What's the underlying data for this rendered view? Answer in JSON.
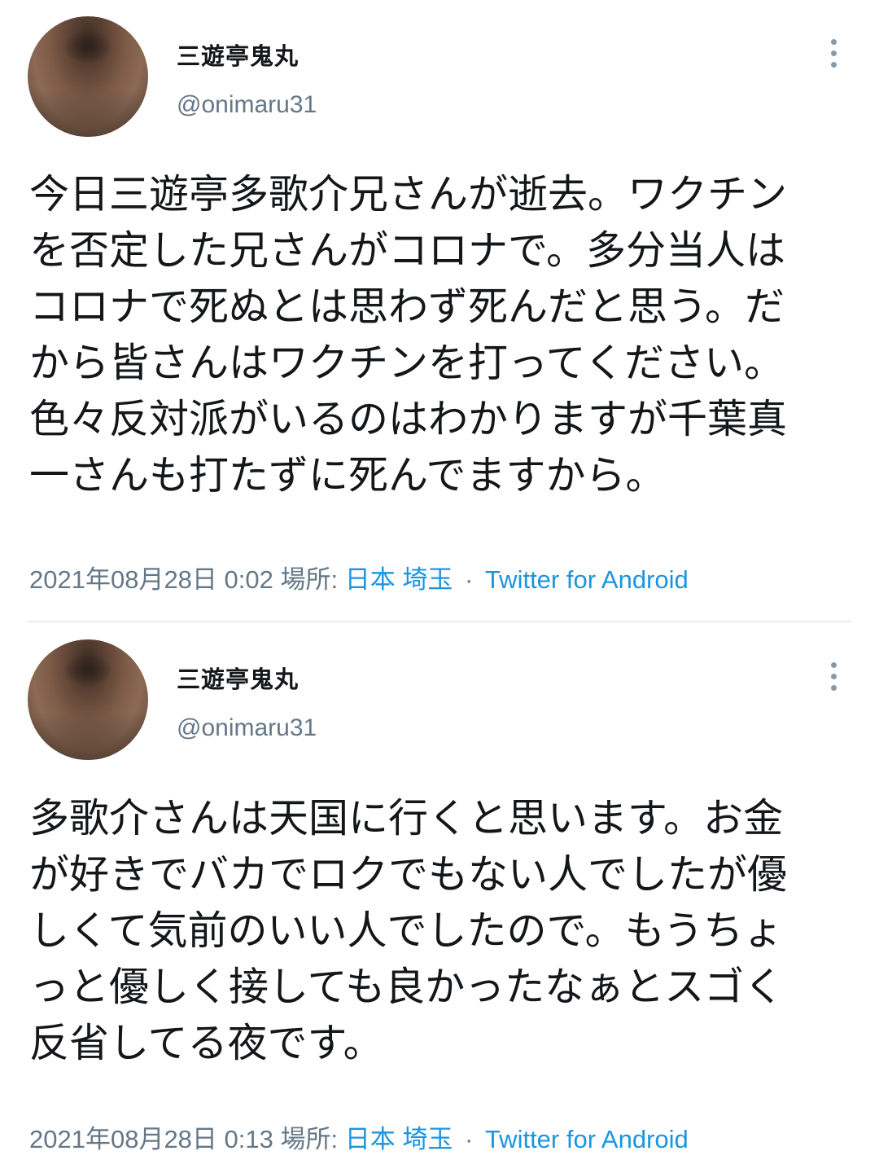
{
  "colors": {
    "text_primary": "#14171a",
    "text_secondary": "#657786",
    "link": "#1b95e0",
    "divider": "#e6ecf0"
  },
  "tweets": [
    {
      "user": {
        "display_name": "三遊亭鬼丸",
        "handle": "@onimaru31"
      },
      "more_icon": "more-vertical-icon",
      "text_lines": [
        "今日三遊亭多歌介兄さんが逝去。ワクチン",
        "を否定した兄さんがコロナで。多分当人は",
        "コロナで死ぬとは思わず死んだと思う。だ",
        "から皆さんはワクチンを打ってください。",
        "色々反対派がいるのはわかりますが千葉真",
        "一さんも打たずに死んでますから。"
      ],
      "timestamp": "2021年08月28日 0:02",
      "location_label": "場所:",
      "location": "日本 埼玉",
      "separator": "·",
      "source": "Twitter for Android"
    },
    {
      "user": {
        "display_name": "三遊亭鬼丸",
        "handle": "@onimaru31"
      },
      "more_icon": "more-vertical-icon",
      "text_lines": [
        "多歌介さんは天国に行くと思います。お金",
        "が好きでバカでロクでもない人でしたが優",
        "しくて気前のいい人でしたので。もうちょ",
        "っと優しく接しても良かったなぁとスゴく",
        "反省してる夜です。"
      ],
      "timestamp": "2021年08月28日 0:13",
      "location_label": "場所:",
      "location": "日本 埼玉",
      "separator": "·",
      "source": "Twitter for Android"
    }
  ]
}
